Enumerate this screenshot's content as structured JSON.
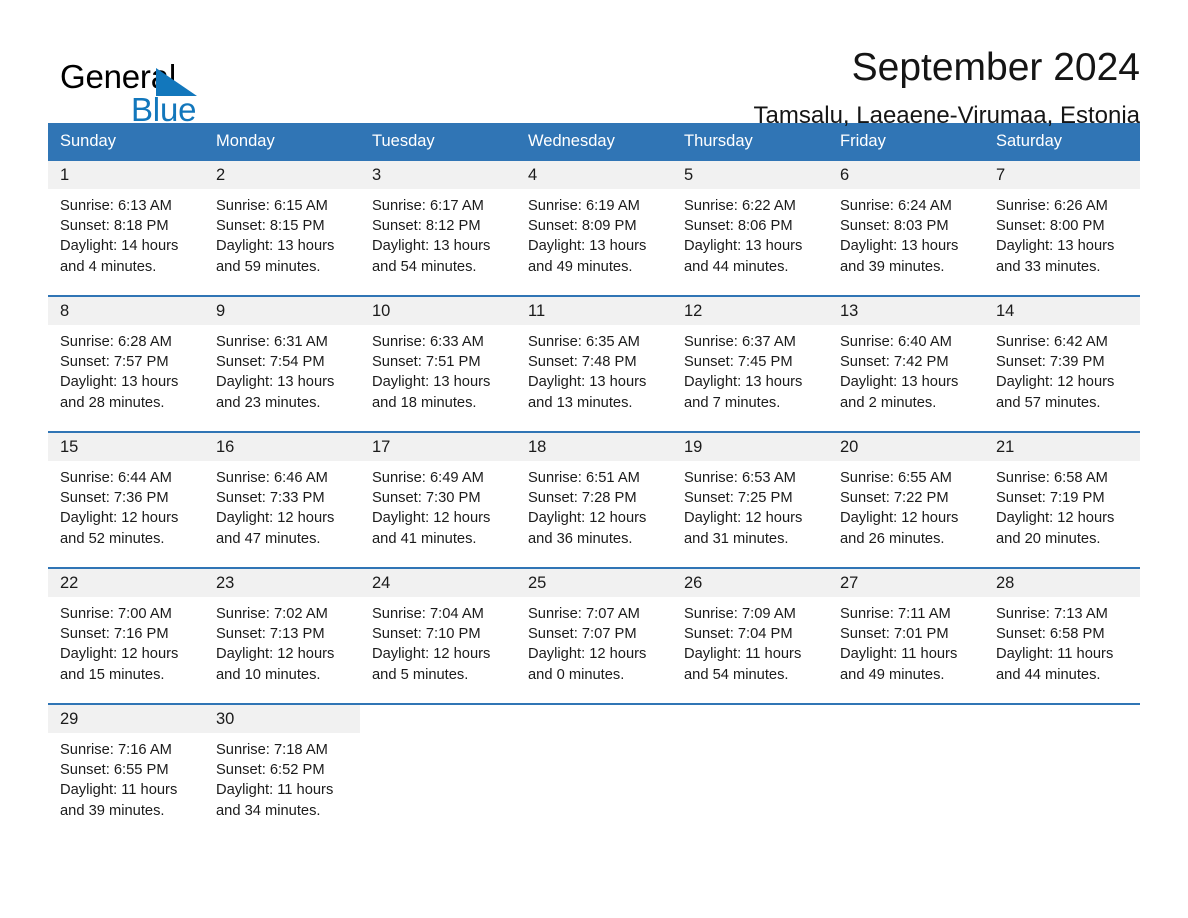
{
  "brand": {
    "word_one": "General",
    "word_two": "Blue",
    "triangle_color": "#1277bc",
    "blue_color": "#1277bc"
  },
  "header": {
    "month_title": "September 2024",
    "location": "Tamsalu, Laeaene-Virumaa, Estonia"
  },
  "theme": {
    "header_blue": "#3075b5",
    "date_band_gray": "#f1f1f1",
    "text_color": "#1b1b1b",
    "page_background": "#ffffff"
  },
  "weekdays": [
    "Sunday",
    "Monday",
    "Tuesday",
    "Wednesday",
    "Thursday",
    "Friday",
    "Saturday"
  ],
  "weeks": [
    [
      {
        "date": "1",
        "sunrise": "Sunrise: 6:13 AM",
        "sunset": "Sunset: 8:18 PM",
        "daylight_line1": "Daylight: 14 hours",
        "daylight_line2": "and 4 minutes."
      },
      {
        "date": "2",
        "sunrise": "Sunrise: 6:15 AM",
        "sunset": "Sunset: 8:15 PM",
        "daylight_line1": "Daylight: 13 hours",
        "daylight_line2": "and 59 minutes."
      },
      {
        "date": "3",
        "sunrise": "Sunrise: 6:17 AM",
        "sunset": "Sunset: 8:12 PM",
        "daylight_line1": "Daylight: 13 hours",
        "daylight_line2": "and 54 minutes."
      },
      {
        "date": "4",
        "sunrise": "Sunrise: 6:19 AM",
        "sunset": "Sunset: 8:09 PM",
        "daylight_line1": "Daylight: 13 hours",
        "daylight_line2": "and 49 minutes."
      },
      {
        "date": "5",
        "sunrise": "Sunrise: 6:22 AM",
        "sunset": "Sunset: 8:06 PM",
        "daylight_line1": "Daylight: 13 hours",
        "daylight_line2": "and 44 minutes."
      },
      {
        "date": "6",
        "sunrise": "Sunrise: 6:24 AM",
        "sunset": "Sunset: 8:03 PM",
        "daylight_line1": "Daylight: 13 hours",
        "daylight_line2": "and 39 minutes."
      },
      {
        "date": "7",
        "sunrise": "Sunrise: 6:26 AM",
        "sunset": "Sunset: 8:00 PM",
        "daylight_line1": "Daylight: 13 hours",
        "daylight_line2": "and 33 minutes."
      }
    ],
    [
      {
        "date": "8",
        "sunrise": "Sunrise: 6:28 AM",
        "sunset": "Sunset: 7:57 PM",
        "daylight_line1": "Daylight: 13 hours",
        "daylight_line2": "and 28 minutes."
      },
      {
        "date": "9",
        "sunrise": "Sunrise: 6:31 AM",
        "sunset": "Sunset: 7:54 PM",
        "daylight_line1": "Daylight: 13 hours",
        "daylight_line2": "and 23 minutes."
      },
      {
        "date": "10",
        "sunrise": "Sunrise: 6:33 AM",
        "sunset": "Sunset: 7:51 PM",
        "daylight_line1": "Daylight: 13 hours",
        "daylight_line2": "and 18 minutes."
      },
      {
        "date": "11",
        "sunrise": "Sunrise: 6:35 AM",
        "sunset": "Sunset: 7:48 PM",
        "daylight_line1": "Daylight: 13 hours",
        "daylight_line2": "and 13 minutes."
      },
      {
        "date": "12",
        "sunrise": "Sunrise: 6:37 AM",
        "sunset": "Sunset: 7:45 PM",
        "daylight_line1": "Daylight: 13 hours",
        "daylight_line2": "and 7 minutes."
      },
      {
        "date": "13",
        "sunrise": "Sunrise: 6:40 AM",
        "sunset": "Sunset: 7:42 PM",
        "daylight_line1": "Daylight: 13 hours",
        "daylight_line2": "and 2 minutes."
      },
      {
        "date": "14",
        "sunrise": "Sunrise: 6:42 AM",
        "sunset": "Sunset: 7:39 PM",
        "daylight_line1": "Daylight: 12 hours",
        "daylight_line2": "and 57 minutes."
      }
    ],
    [
      {
        "date": "15",
        "sunrise": "Sunrise: 6:44 AM",
        "sunset": "Sunset: 7:36 PM",
        "daylight_line1": "Daylight: 12 hours",
        "daylight_line2": "and 52 minutes."
      },
      {
        "date": "16",
        "sunrise": "Sunrise: 6:46 AM",
        "sunset": "Sunset: 7:33 PM",
        "daylight_line1": "Daylight: 12 hours",
        "daylight_line2": "and 47 minutes."
      },
      {
        "date": "17",
        "sunrise": "Sunrise: 6:49 AM",
        "sunset": "Sunset: 7:30 PM",
        "daylight_line1": "Daylight: 12 hours",
        "daylight_line2": "and 41 minutes."
      },
      {
        "date": "18",
        "sunrise": "Sunrise: 6:51 AM",
        "sunset": "Sunset: 7:28 PM",
        "daylight_line1": "Daylight: 12 hours",
        "daylight_line2": "and 36 minutes."
      },
      {
        "date": "19",
        "sunrise": "Sunrise: 6:53 AM",
        "sunset": "Sunset: 7:25 PM",
        "daylight_line1": "Daylight: 12 hours",
        "daylight_line2": "and 31 minutes."
      },
      {
        "date": "20",
        "sunrise": "Sunrise: 6:55 AM",
        "sunset": "Sunset: 7:22 PM",
        "daylight_line1": "Daylight: 12 hours",
        "daylight_line2": "and 26 minutes."
      },
      {
        "date": "21",
        "sunrise": "Sunrise: 6:58 AM",
        "sunset": "Sunset: 7:19 PM",
        "daylight_line1": "Daylight: 12 hours",
        "daylight_line2": "and 20 minutes."
      }
    ],
    [
      {
        "date": "22",
        "sunrise": "Sunrise: 7:00 AM",
        "sunset": "Sunset: 7:16 PM",
        "daylight_line1": "Daylight: 12 hours",
        "daylight_line2": "and 15 minutes."
      },
      {
        "date": "23",
        "sunrise": "Sunrise: 7:02 AM",
        "sunset": "Sunset: 7:13 PM",
        "daylight_line1": "Daylight: 12 hours",
        "daylight_line2": "and 10 minutes."
      },
      {
        "date": "24",
        "sunrise": "Sunrise: 7:04 AM",
        "sunset": "Sunset: 7:10 PM",
        "daylight_line1": "Daylight: 12 hours",
        "daylight_line2": "and 5 minutes."
      },
      {
        "date": "25",
        "sunrise": "Sunrise: 7:07 AM",
        "sunset": "Sunset: 7:07 PM",
        "daylight_line1": "Daylight: 12 hours",
        "daylight_line2": "and 0 minutes."
      },
      {
        "date": "26",
        "sunrise": "Sunrise: 7:09 AM",
        "sunset": "Sunset: 7:04 PM",
        "daylight_line1": "Daylight: 11 hours",
        "daylight_line2": "and 54 minutes."
      },
      {
        "date": "27",
        "sunrise": "Sunrise: 7:11 AM",
        "sunset": "Sunset: 7:01 PM",
        "daylight_line1": "Daylight: 11 hours",
        "daylight_line2": "and 49 minutes."
      },
      {
        "date": "28",
        "sunrise": "Sunrise: 7:13 AM",
        "sunset": "Sunset: 6:58 PM",
        "daylight_line1": "Daylight: 11 hours",
        "daylight_line2": "and 44 minutes."
      }
    ],
    [
      {
        "date": "29",
        "sunrise": "Sunrise: 7:16 AM",
        "sunset": "Sunset: 6:55 PM",
        "daylight_line1": "Daylight: 11 hours",
        "daylight_line2": "and 39 minutes."
      },
      {
        "date": "30",
        "sunrise": "Sunrise: 7:18 AM",
        "sunset": "Sunset: 6:52 PM",
        "daylight_line1": "Daylight: 11 hours",
        "daylight_line2": "and 34 minutes."
      },
      {
        "date": "",
        "sunrise": "",
        "sunset": "",
        "daylight_line1": "",
        "daylight_line2": ""
      },
      {
        "date": "",
        "sunrise": "",
        "sunset": "",
        "daylight_line1": "",
        "daylight_line2": ""
      },
      {
        "date": "",
        "sunrise": "",
        "sunset": "",
        "daylight_line1": "",
        "daylight_line2": ""
      },
      {
        "date": "",
        "sunrise": "",
        "sunset": "",
        "daylight_line1": "",
        "daylight_line2": ""
      },
      {
        "date": "",
        "sunrise": "",
        "sunset": "",
        "daylight_line1": "",
        "daylight_line2": ""
      }
    ]
  ]
}
